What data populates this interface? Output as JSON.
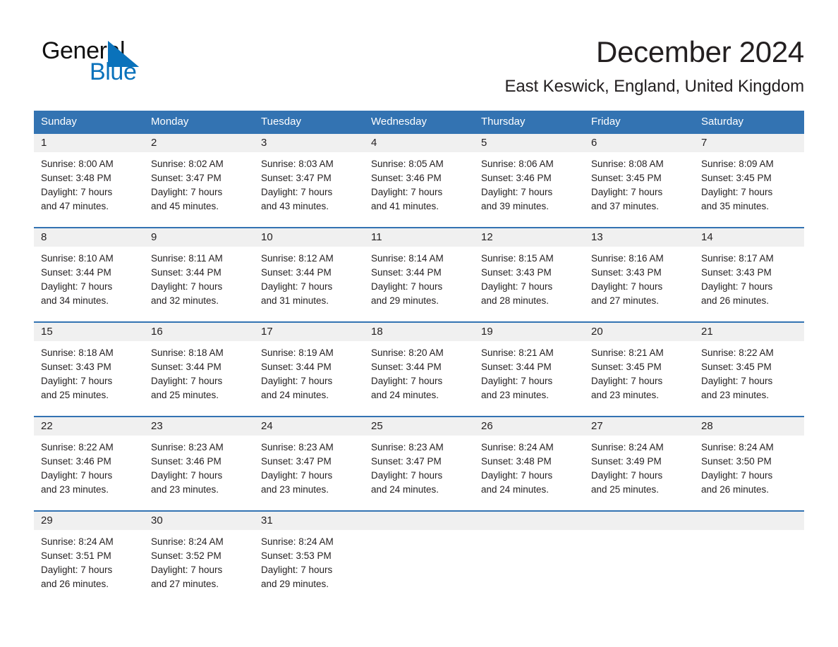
{
  "brand": {
    "name_part1": "General",
    "name_part2": "Blue",
    "triangle_icon": "triangle-icon",
    "color_black": "#111111",
    "color_blue": "#0a72bb"
  },
  "header": {
    "month_title": "December 2024",
    "location": "East Keswick, England, United Kingdom"
  },
  "theme": {
    "header_blue": "#3373b2",
    "daynum_band": "#f0f0f0",
    "text": "#231f20"
  },
  "calendar": {
    "weekdays": [
      "Sunday",
      "Monday",
      "Tuesday",
      "Wednesday",
      "Thursday",
      "Friday",
      "Saturday"
    ],
    "weeks": [
      [
        {
          "day": "1",
          "sunrise": "Sunrise: 8:00 AM",
          "sunset": "Sunset: 3:48 PM",
          "daylight_l1": "Daylight: 7 hours",
          "daylight_l2": "and 47 minutes."
        },
        {
          "day": "2",
          "sunrise": "Sunrise: 8:02 AM",
          "sunset": "Sunset: 3:47 PM",
          "daylight_l1": "Daylight: 7 hours",
          "daylight_l2": "and 45 minutes."
        },
        {
          "day": "3",
          "sunrise": "Sunrise: 8:03 AM",
          "sunset": "Sunset: 3:47 PM",
          "daylight_l1": "Daylight: 7 hours",
          "daylight_l2": "and 43 minutes."
        },
        {
          "day": "4",
          "sunrise": "Sunrise: 8:05 AM",
          "sunset": "Sunset: 3:46 PM",
          "daylight_l1": "Daylight: 7 hours",
          "daylight_l2": "and 41 minutes."
        },
        {
          "day": "5",
          "sunrise": "Sunrise: 8:06 AM",
          "sunset": "Sunset: 3:46 PM",
          "daylight_l1": "Daylight: 7 hours",
          "daylight_l2": "and 39 minutes."
        },
        {
          "day": "6",
          "sunrise": "Sunrise: 8:08 AM",
          "sunset": "Sunset: 3:45 PM",
          "daylight_l1": "Daylight: 7 hours",
          "daylight_l2": "and 37 minutes."
        },
        {
          "day": "7",
          "sunrise": "Sunrise: 8:09 AM",
          "sunset": "Sunset: 3:45 PM",
          "daylight_l1": "Daylight: 7 hours",
          "daylight_l2": "and 35 minutes."
        }
      ],
      [
        {
          "day": "8",
          "sunrise": "Sunrise: 8:10 AM",
          "sunset": "Sunset: 3:44 PM",
          "daylight_l1": "Daylight: 7 hours",
          "daylight_l2": "and 34 minutes."
        },
        {
          "day": "9",
          "sunrise": "Sunrise: 8:11 AM",
          "sunset": "Sunset: 3:44 PM",
          "daylight_l1": "Daylight: 7 hours",
          "daylight_l2": "and 32 minutes."
        },
        {
          "day": "10",
          "sunrise": "Sunrise: 8:12 AM",
          "sunset": "Sunset: 3:44 PM",
          "daylight_l1": "Daylight: 7 hours",
          "daylight_l2": "and 31 minutes."
        },
        {
          "day": "11",
          "sunrise": "Sunrise: 8:14 AM",
          "sunset": "Sunset: 3:44 PM",
          "daylight_l1": "Daylight: 7 hours",
          "daylight_l2": "and 29 minutes."
        },
        {
          "day": "12",
          "sunrise": "Sunrise: 8:15 AM",
          "sunset": "Sunset: 3:43 PM",
          "daylight_l1": "Daylight: 7 hours",
          "daylight_l2": "and 28 minutes."
        },
        {
          "day": "13",
          "sunrise": "Sunrise: 8:16 AM",
          "sunset": "Sunset: 3:43 PM",
          "daylight_l1": "Daylight: 7 hours",
          "daylight_l2": "and 27 minutes."
        },
        {
          "day": "14",
          "sunrise": "Sunrise: 8:17 AM",
          "sunset": "Sunset: 3:43 PM",
          "daylight_l1": "Daylight: 7 hours",
          "daylight_l2": "and 26 minutes."
        }
      ],
      [
        {
          "day": "15",
          "sunrise": "Sunrise: 8:18 AM",
          "sunset": "Sunset: 3:43 PM",
          "daylight_l1": "Daylight: 7 hours",
          "daylight_l2": "and 25 minutes."
        },
        {
          "day": "16",
          "sunrise": "Sunrise: 8:18 AM",
          "sunset": "Sunset: 3:44 PM",
          "daylight_l1": "Daylight: 7 hours",
          "daylight_l2": "and 25 minutes."
        },
        {
          "day": "17",
          "sunrise": "Sunrise: 8:19 AM",
          "sunset": "Sunset: 3:44 PM",
          "daylight_l1": "Daylight: 7 hours",
          "daylight_l2": "and 24 minutes."
        },
        {
          "day": "18",
          "sunrise": "Sunrise: 8:20 AM",
          "sunset": "Sunset: 3:44 PM",
          "daylight_l1": "Daylight: 7 hours",
          "daylight_l2": "and 24 minutes."
        },
        {
          "day": "19",
          "sunrise": "Sunrise: 8:21 AM",
          "sunset": "Sunset: 3:44 PM",
          "daylight_l1": "Daylight: 7 hours",
          "daylight_l2": "and 23 minutes."
        },
        {
          "day": "20",
          "sunrise": "Sunrise: 8:21 AM",
          "sunset": "Sunset: 3:45 PM",
          "daylight_l1": "Daylight: 7 hours",
          "daylight_l2": "and 23 minutes."
        },
        {
          "day": "21",
          "sunrise": "Sunrise: 8:22 AM",
          "sunset": "Sunset: 3:45 PM",
          "daylight_l1": "Daylight: 7 hours",
          "daylight_l2": "and 23 minutes."
        }
      ],
      [
        {
          "day": "22",
          "sunrise": "Sunrise: 8:22 AM",
          "sunset": "Sunset: 3:46 PM",
          "daylight_l1": "Daylight: 7 hours",
          "daylight_l2": "and 23 minutes."
        },
        {
          "day": "23",
          "sunrise": "Sunrise: 8:23 AM",
          "sunset": "Sunset: 3:46 PM",
          "daylight_l1": "Daylight: 7 hours",
          "daylight_l2": "and 23 minutes."
        },
        {
          "day": "24",
          "sunrise": "Sunrise: 8:23 AM",
          "sunset": "Sunset: 3:47 PM",
          "daylight_l1": "Daylight: 7 hours",
          "daylight_l2": "and 23 minutes."
        },
        {
          "day": "25",
          "sunrise": "Sunrise: 8:23 AM",
          "sunset": "Sunset: 3:47 PM",
          "daylight_l1": "Daylight: 7 hours",
          "daylight_l2": "and 24 minutes."
        },
        {
          "day": "26",
          "sunrise": "Sunrise: 8:24 AM",
          "sunset": "Sunset: 3:48 PM",
          "daylight_l1": "Daylight: 7 hours",
          "daylight_l2": "and 24 minutes."
        },
        {
          "day": "27",
          "sunrise": "Sunrise: 8:24 AM",
          "sunset": "Sunset: 3:49 PM",
          "daylight_l1": "Daylight: 7 hours",
          "daylight_l2": "and 25 minutes."
        },
        {
          "day": "28",
          "sunrise": "Sunrise: 8:24 AM",
          "sunset": "Sunset: 3:50 PM",
          "daylight_l1": "Daylight: 7 hours",
          "daylight_l2": "and 26 minutes."
        }
      ],
      [
        {
          "day": "29",
          "sunrise": "Sunrise: 8:24 AM",
          "sunset": "Sunset: 3:51 PM",
          "daylight_l1": "Daylight: 7 hours",
          "daylight_l2": "and 26 minutes."
        },
        {
          "day": "30",
          "sunrise": "Sunrise: 8:24 AM",
          "sunset": "Sunset: 3:52 PM",
          "daylight_l1": "Daylight: 7 hours",
          "daylight_l2": "and 27 minutes."
        },
        {
          "day": "31",
          "sunrise": "Sunrise: 8:24 AM",
          "sunset": "Sunset: 3:53 PM",
          "daylight_l1": "Daylight: 7 hours",
          "daylight_l2": "and 29 minutes."
        },
        {
          "day": "",
          "sunrise": "",
          "sunset": "",
          "daylight_l1": "",
          "daylight_l2": ""
        },
        {
          "day": "",
          "sunrise": "",
          "sunset": "",
          "daylight_l1": "",
          "daylight_l2": ""
        },
        {
          "day": "",
          "sunrise": "",
          "sunset": "",
          "daylight_l1": "",
          "daylight_l2": ""
        },
        {
          "day": "",
          "sunrise": "",
          "sunset": "",
          "daylight_l1": "",
          "daylight_l2": ""
        }
      ]
    ]
  }
}
